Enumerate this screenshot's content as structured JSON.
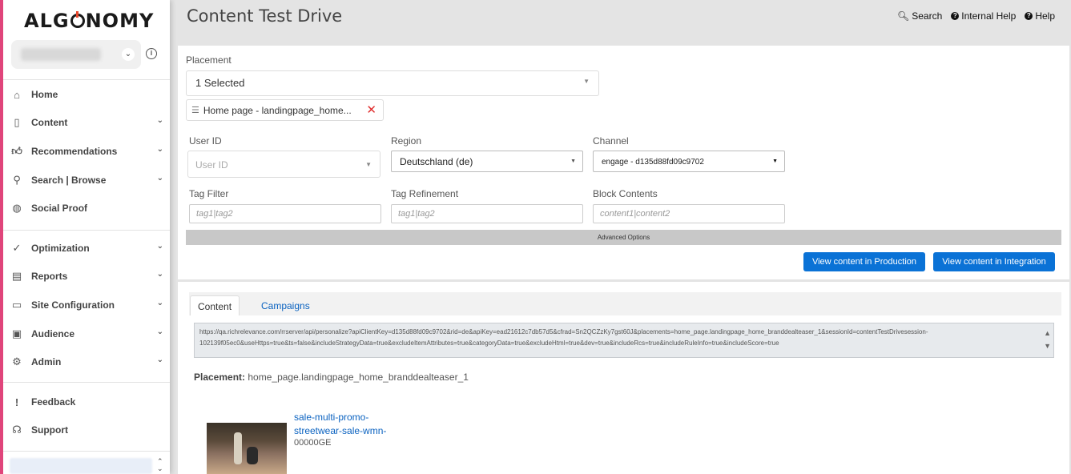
{
  "sidebar": {
    "logo": "ALGONOMY",
    "nav": [
      {
        "label": "Home",
        "icon": "home-icon",
        "caret": false
      },
      {
        "label": "Content",
        "icon": "clipboard-icon",
        "caret": true
      },
      {
        "label": "Recommendations",
        "icon": "thumbs-up-icon",
        "caret": true
      },
      {
        "label": "Search | Browse",
        "icon": "search-icon",
        "caret": true
      },
      {
        "label": "Social Proof",
        "icon": "globe-icon",
        "caret": false
      },
      {
        "label": "Optimization",
        "icon": "check-plus-icon",
        "caret": true
      },
      {
        "label": "Reports",
        "icon": "report-icon",
        "caret": true
      },
      {
        "label": "Site Configuration",
        "icon": "window-icon",
        "caret": true
      },
      {
        "label": "Audience",
        "icon": "person-box-icon",
        "caret": true
      },
      {
        "label": "Admin",
        "icon": "admin-gear-icon",
        "caret": true
      },
      {
        "label": "Feedback",
        "icon": "feedback-icon",
        "caret": false
      },
      {
        "label": "Support",
        "icon": "headset-icon",
        "caret": false
      }
    ]
  },
  "header": {
    "title": "Content Test Drive",
    "links": {
      "search": "Search",
      "internal_help": "Internal Help",
      "help": "Help"
    }
  },
  "form": {
    "placement_label": "Placement",
    "placement_value": "1 Selected",
    "chip_label": "Home page - landingpage_home...",
    "user_id_label": "User ID",
    "user_id_placeholder": "User ID",
    "region_label": "Region",
    "region_value": "Deutschland (de)",
    "channel_label": "Channel",
    "channel_value": "engage - d135d88fd09c9702",
    "tag_filter_label": "Tag Filter",
    "tag_filter_placeholder": "tag1|tag2",
    "tag_refinement_label": "Tag Refinement",
    "tag_refinement_placeholder": "tag1|tag2",
    "block_contents_label": "Block Contents",
    "block_contents_placeholder": "content1|content2",
    "advanced_options": "Advanced Options",
    "btn_production": "View content in Production",
    "btn_integration": "View content in Integration"
  },
  "results": {
    "tabs": [
      "Content",
      "Campaigns"
    ],
    "url": "https://qa.richrelevance.com/rrserver/api/personalize?apiClientKey=d135d88fd09c9702&rid=de&apiKey=ead21612c7db57d5&cfrad=Sn2QCZzKy7gst60J&placements=home_page.landingpage_home_branddealteaser_1&sessionId=contentTestDrivesession-102139f05ec0&useHttps=true&ts=false&includeStrategyData=true&excludeItemAttributes=true&categoryData=true&excludeHtml=true&dev=true&includeRcs=true&includeRuleInfo=true&includeScore=true",
    "placement_prefix": "Placement:",
    "placement_value": "home_page.landingpage_home_branddealteaser_1",
    "product_link_1": "sale-multi-promo-",
    "product_link_2": "streetwear-sale-wmn-",
    "product_id": "00000GE"
  }
}
